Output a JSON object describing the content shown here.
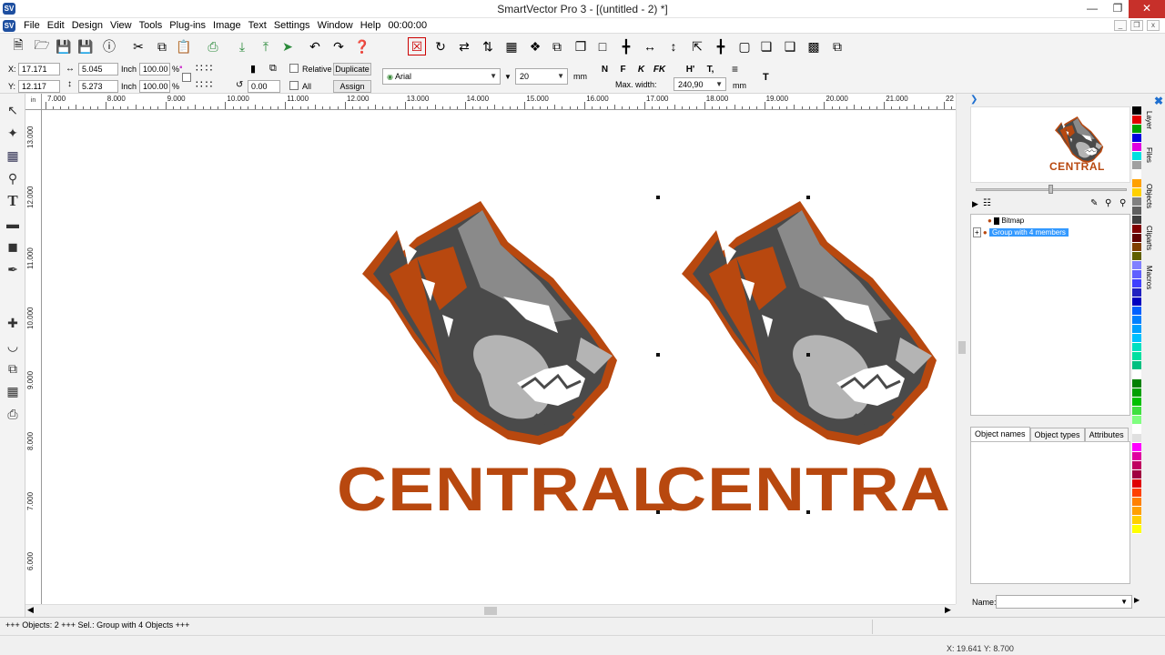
{
  "window": {
    "title": "SmartVector Pro 3 - [(untitled - 2) *]",
    "app_icon": "SV"
  },
  "menu": {
    "items": [
      "File",
      "Edit",
      "Design",
      "View",
      "Tools",
      "Plug-ins",
      "Image",
      "Text",
      "Settings",
      "Window",
      "Help"
    ],
    "timer": "00:00:00"
  },
  "toolbar1": {
    "icons": [
      "new-icon",
      "open-icon",
      "save-icon",
      "save-as-icon",
      "info-icon",
      "cut-icon",
      "copy-icon",
      "paste-icon",
      "print-icon",
      "import-icon",
      "export-icon",
      "send-icon",
      "undo-icon",
      "redo-icon",
      "help-icon",
      "delete-node-icon",
      "rotate-icon",
      "mirror-icon",
      "flip-icon",
      "select-nodes-icon",
      "break-icon",
      "combine-icon",
      "duplicate-icon",
      "rectangle-icon",
      "align-center-icon",
      "distribute-h-icon",
      "distribute-v-icon",
      "align-top-left-icon",
      "align-center-icon",
      "frame-icon",
      "group-icon",
      "ungroup-icon",
      "arrange-icon",
      "layer-icon"
    ]
  },
  "props": {
    "x_label": "X:",
    "x_value": "17.171",
    "y_label": "Y:",
    "y_value": "12.117",
    "w_value": "5.045",
    "h_value": "5.273",
    "unit": "Inch",
    "scale_w": "100.00",
    "scale_h": "100.00",
    "percent": "%",
    "angle": "0.00",
    "relative_label": "Relative",
    "all_label": "All",
    "duplicate_label": "Duplicate",
    "assign_label": "Assign",
    "font": "Arial",
    "font_size": "20",
    "font_unit": "mm",
    "format_buttons": [
      "N",
      "F",
      "K",
      "FK",
      "H'",
      "T,"
    ],
    "max_width_label": "Max. width:",
    "max_width_value": "240,90",
    "max_width_unit": "mm",
    "text_tool": "T"
  },
  "rulers": {
    "corner": "in",
    "h_ticks": [
      "7.000",
      "8.000",
      "9.000",
      "10.000",
      "11.000",
      "12.000",
      "13.000",
      "14.000",
      "15.000",
      "16.000",
      "17.000",
      "18.000",
      "19.000",
      "20.000",
      "21.000",
      "22"
    ],
    "v_ticks": [
      "13.000",
      "12.000",
      "11.000",
      "10.000",
      "9.000",
      "8.000",
      "7.000",
      "6.000"
    ]
  },
  "canvas": {
    "logo_text_left": "CENTRAL",
    "logo_text_right": "CENTRAL",
    "colors": {
      "orange": "#b8480f",
      "dark_gray": "#4a4a4a",
      "mid_gray": "#8a8a8a",
      "light_gray": "#b4b4b4"
    }
  },
  "right_panel": {
    "preview_text": "CENTRAL",
    "tree": [
      {
        "label": "Bitmap",
        "selected": false
      },
      {
        "label": "Group with 4 members",
        "selected": true
      }
    ],
    "tabs": [
      "Object names",
      "Object types",
      "Attributes"
    ],
    "active_tab": "Object names",
    "name_label": "Name:",
    "side_tabs": [
      "Layer",
      "Files",
      "Objects",
      "Cliparts",
      "Macros"
    ]
  },
  "palette": [
    "#000000",
    "#e00000",
    "#00a000",
    "#0000e0",
    "#e000e0",
    "#00e0e0",
    "#a0a0a0",
    "#ffffff",
    "#ffa000",
    "#ffd000",
    "#808080",
    "#606060",
    "#404040",
    "#800000",
    "#600000",
    "#804000",
    "#606000",
    "#8080ff",
    "#6060ff",
    "#4040ff",
    "#2020c0",
    "#0000c0",
    "#0060ff",
    "#0080ff",
    "#00a0ff",
    "#00c0ff",
    "#00e0c0",
    "#00e0a0",
    "#00c080",
    "#ffffff",
    "#008000",
    "#00a000",
    "#00c000",
    "#40e040",
    "#80ff80",
    "#ffffff",
    "#e0e0e0",
    "#ff00ff",
    "#e000a0",
    "#c00060",
    "#a00040",
    "#e00000",
    "#ff4000",
    "#ff8000",
    "#ffa000",
    "#ffd000",
    "#ffff00"
  ],
  "status": {
    "text": "+++ Objects: 2 +++ Sel.: Group with 4 Objects  +++",
    "coords": "X: 19.641 Y: 8.700"
  }
}
